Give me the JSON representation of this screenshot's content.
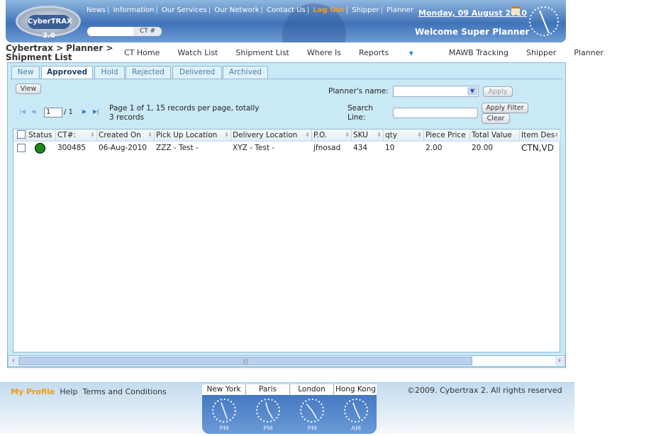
{
  "header": {
    "logo_text": "CyberTRAX 2.0",
    "top_links": [
      "News",
      "Information",
      "Our Services",
      "Our Network",
      "Contact Us",
      "Log Out",
      "Shipper",
      "Planner"
    ],
    "ct_button": "CT #",
    "ct_value": "",
    "date": "Monday, 09 August 2010",
    "welcome": "Welcome  Super Planner"
  },
  "breadcrumb": {
    "line1": "Cybertrax > Planner >",
    "line2": "Shipment List"
  },
  "nav": [
    "CT Home",
    "Watch List",
    "Shipment List",
    "Where Is",
    "Reports",
    "MAWB Tracking",
    "Shipper",
    "Planner"
  ],
  "tabs": [
    {
      "label": "New"
    },
    {
      "label": "Approved",
      "active": true
    },
    {
      "label": "Hold"
    },
    {
      "label": "Rejected"
    },
    {
      "label": "Delivered"
    },
    {
      "label": "Archived"
    }
  ],
  "toolbar": {
    "view": "View",
    "planner_label": "Planner's name:",
    "planner_value": "",
    "apply": "Apply",
    "search_label": "Search Line:",
    "search_value": "",
    "apply_filter": "Apply Filter",
    "clear": "Clear"
  },
  "pager": {
    "page_input": "1",
    "page_total": "/ 1",
    "info": "Page 1 of 1, 15 records per page, totally 3 records"
  },
  "grid": {
    "columns": [
      "Status",
      "CT#:",
      "Created On",
      "Pick Up Location",
      "Delivery Location",
      "P.O.",
      "SKU",
      "qty",
      "Piece Price",
      "Total Value",
      "Item Des"
    ],
    "rows": [
      {
        "status_color": "#1a8a1a",
        "ct": "300485",
        "created": "06-Aug-2010",
        "pickup": "ZZZ - Test -",
        "delivery": "XYZ - Test -",
        "po": "jfnosad",
        "sku": "434",
        "qty": "10",
        "piece_price": "2.00",
        "total_value": "20.00",
        "item_des": "CTN,VD"
      }
    ]
  },
  "footer": {
    "my_profile": "My Profile",
    "help": "Help",
    "terms": "Terms and Conditions",
    "copyright": "©2009. Cybertrax 2. All rights reserved",
    "clocks": [
      {
        "city": "New York",
        "ampm": "PM"
      },
      {
        "city": "Paris",
        "ampm": "PM"
      },
      {
        "city": "London",
        "ampm": "PM"
      },
      {
        "city": "Hong Kong",
        "ampm": "AM"
      }
    ]
  }
}
